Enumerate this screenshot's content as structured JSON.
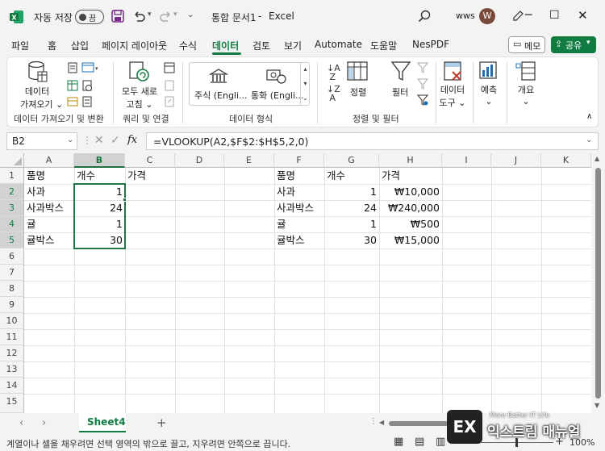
{
  "titlebar": {
    "autosave_label": "자동 저장",
    "autosave_state": "끔",
    "doc_title": "통합 문서1",
    "separator": "-",
    "app_name": "Excel",
    "user_name": "wws",
    "avatar_letter": "W"
  },
  "tabs": [
    "파일",
    "홈",
    "삽입",
    "페이지 레이아웃",
    "수식",
    "데이터",
    "검토",
    "보기",
    "Automate",
    "도움말",
    "NesPDF"
  ],
  "active_tab": "데이터",
  "memo_label": "메모",
  "share_label": "공유",
  "ribbon": {
    "get_data_label_1": "데이터",
    "get_data_label_2": "가져오기",
    "group1": "데이터 가져오기 및 변환",
    "refresh_label_1": "모두 새로",
    "refresh_label_2": "고침",
    "group2": "쿼리 및 연결",
    "stock_label": "주식 (Engli...",
    "currency_label": "통화 (Engli...",
    "group3": "데이터 형식",
    "sort_label": "정렬",
    "filter_label": "필터",
    "group4": "정렬 및 필터",
    "data_tools_label_1": "데이터",
    "data_tools_label_2": "도구",
    "forecast_label": "예측",
    "outline_label": "개요"
  },
  "formula_bar": {
    "name_box": "B2",
    "fx": "fx",
    "formula": "=VLOOKUP(A2,$F$2:$H$5,2,0)"
  },
  "columns": [
    "A",
    "B",
    "C",
    "D",
    "E",
    "F",
    "G",
    "H",
    "I",
    "J",
    "K"
  ],
  "rows": [
    "1",
    "2",
    "3",
    "4",
    "5",
    "6",
    "7",
    "8",
    "9",
    "10",
    "11",
    "12",
    "13",
    "14",
    "15"
  ],
  "cells": {
    "A1": "품명",
    "B1": "개수",
    "C1": "가격",
    "A2": "사과",
    "B2": "1",
    "A3": "사과박스",
    "B3": "24",
    "A4": "귤",
    "B4": "1",
    "A5": "귤박스",
    "B5": "30",
    "F1": "품명",
    "G1": "개수",
    "H1": "가격",
    "F2": "사과",
    "G2": "1",
    "H2": "₩10,000",
    "F3": "사과박스",
    "G3": "24",
    "H3": "₩240,000",
    "F4": "귤",
    "G4": "1",
    "H4": "₩500",
    "F5": "귤박스",
    "G5": "30",
    "H5": "₩15,000"
  },
  "sheet_tab": "Sheet4",
  "status_text": "계열이나 셀을 채우려면 선택 영역의 밖으로 끌고, 지우려면 안쪽으로 끕니다.",
  "zoom": "100%",
  "watermark": {
    "small": "More Better IT Life",
    "big": "익스트림 매뉴얼",
    "logo": "EX"
  },
  "colors": {
    "excel_green": "#107c41",
    "selection_green": "#217346",
    "accent_avatar": "#7a4a3a"
  }
}
